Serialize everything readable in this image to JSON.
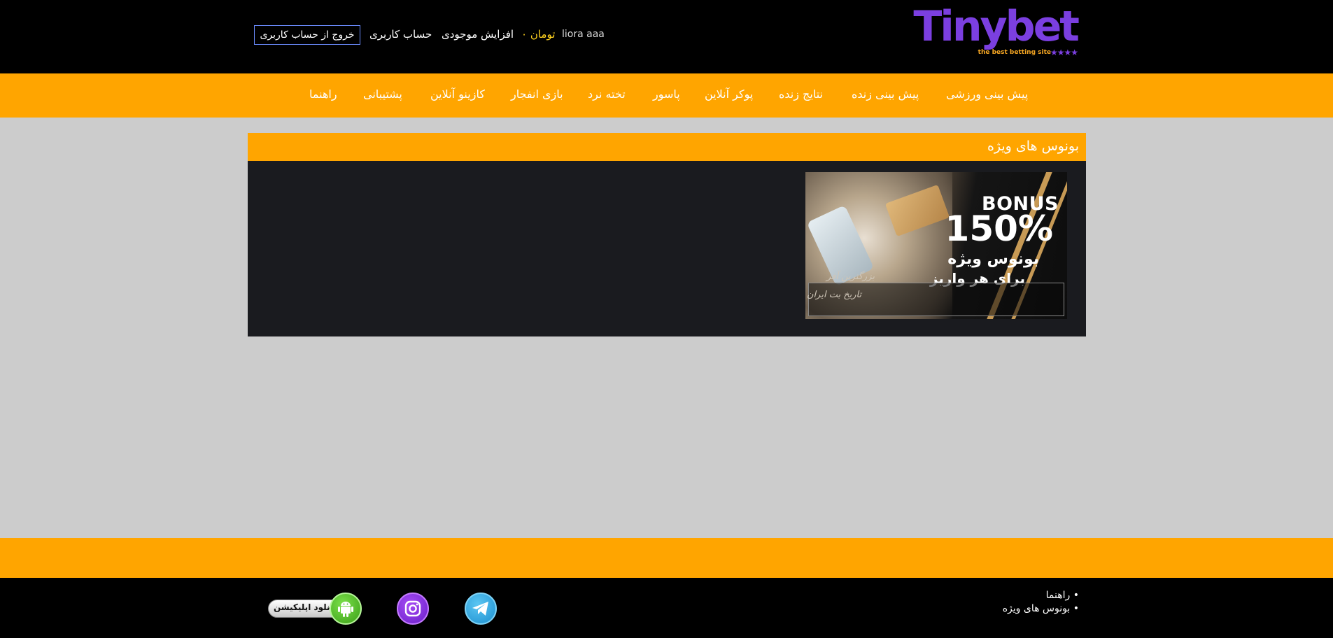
{
  "header": {
    "logo": {
      "brand": "Tinybet",
      "tagline": "the best betting site",
      "stars": "★★★★"
    },
    "user_name": "liora aaa",
    "balance": "تومان ۰",
    "deposit_label": "افزایش موجودی",
    "account_label": "حساب کاربری",
    "logout_label": "خروج از حساب کاربری"
  },
  "nav": {
    "items": [
      {
        "label": "پیش بینی ورزشی"
      },
      {
        "label": "پیش بینی زنده"
      },
      {
        "label": "نتایج زنده"
      },
      {
        "label": "پوکر آنلاین"
      },
      {
        "label": "پاسور"
      },
      {
        "label": "تخته نرد"
      },
      {
        "label": "بازی انفجار"
      },
      {
        "label": "کازینو آنلاین"
      },
      {
        "label": "پشتیبانی"
      },
      {
        "label": "راهنما"
      }
    ]
  },
  "content": {
    "section_title": "بونوس های ویژه",
    "banner": {
      "bonus_word": "BONUS",
      "bonus_percent": "150%",
      "line1": "بونوس ویژه",
      "line2": "برای هر واریز",
      "caption1": "بزرگترین آفر",
      "caption2": "تاریخ بت ایران"
    }
  },
  "footer": {
    "links": [
      {
        "label": "راهنما"
      },
      {
        "label": "بونوس های ویژه"
      }
    ],
    "app_label": "دانلود اپلیکیشن"
  },
  "colors": {
    "header_bg": "#000000",
    "accent_orange": "#ffa500",
    "page_bg": "#cccccc",
    "panel_bg": "#1a1b1f",
    "brand_purple": "#7b3fe0",
    "balance_yellow": "#ffd21f"
  },
  "icons": {
    "telegram": "telegram-icon",
    "instagram": "instagram-icon",
    "android": "android-icon"
  }
}
